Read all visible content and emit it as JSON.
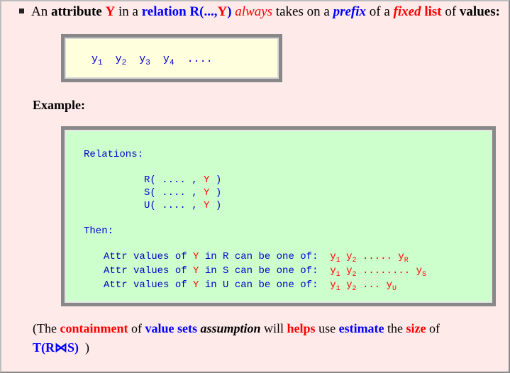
{
  "bullet": {
    "w1": "An",
    "w2": "attribute",
    "w3": "Y",
    "w4": "in a",
    "w5": "relation R(...,",
    "w6": "Y",
    "w7": ")",
    "w8": "always",
    "w9": "takes on a",
    "w10": "prefix",
    "w11": "of a",
    "w12": "fixed",
    "w13": "list",
    "w14": "of",
    "w15": "values",
    "w16": ":"
  },
  "ybox": {
    "y": "y",
    "subs": [
      "1",
      "2",
      "3",
      "4"
    ],
    "ellipsis": "...."
  },
  "example_label": "Example:",
  "green": {
    "relations_label": "Relations:",
    "rels": [
      {
        "name": "R",
        "pre": "R( .... , ",
        "y": "Y",
        "post": " )"
      },
      {
        "name": "S",
        "pre": "S( .... , ",
        "y": "Y",
        "post": " )"
      },
      {
        "name": "U",
        "pre": "U( .... , ",
        "y": "Y",
        "post": " )"
      }
    ],
    "then_label": "Then:",
    "attr_rows": [
      {
        "pre": "Attr values of ",
        "y": "Y",
        "post": " in R can be one of:",
        "s1": "1",
        "s2": "2",
        "dots": ".....",
        "last": "R"
      },
      {
        "pre": "Attr values of ",
        "y": "Y",
        "post": " in S can be one of:",
        "s1": "1",
        "s2": "2",
        "dots": "........",
        "last": "S"
      },
      {
        "pre": "Attr values of ",
        "y": "Y",
        "post": " in U can be one of:",
        "s1": "1",
        "s2": "2",
        "dots": "...",
        "last": "U"
      }
    ],
    "yvar": "y"
  },
  "bottom": {
    "open": "(The",
    "containment": "containment",
    "of": "of",
    "value_sets": "value sets",
    "assumption": "assumption",
    "will": "will",
    "helps": "helps",
    "use": "use",
    "estimate": "estimate",
    "the": "the",
    "size": "size",
    "of2": "of",
    "join": "T(R⋈S)",
    "close": ")"
  }
}
